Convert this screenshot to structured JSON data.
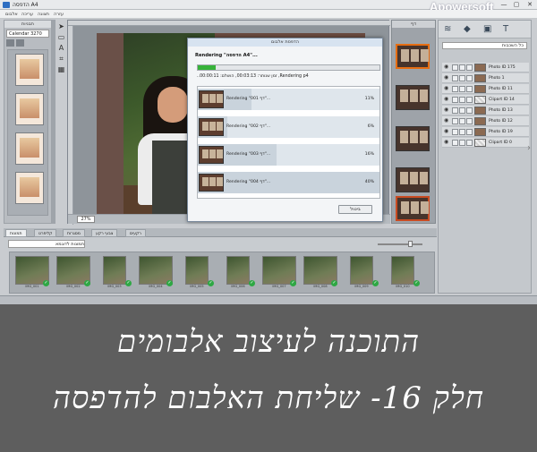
{
  "window": {
    "title": "הדפסה A4",
    "watermark": "Apowersoft",
    "controls": [
      "—",
      "▢",
      "✕"
    ]
  },
  "menu": {
    "items": [
      "אלבום",
      "עריכה",
      "תצוגה",
      "עזרה"
    ]
  },
  "left_panel": {
    "header": "תבניות",
    "dropdown": "Calendar 3270"
  },
  "canvas": {
    "zoom": "27%"
  },
  "render_dialog": {
    "title": "הדפסת אלבום",
    "heading": "Rendering \"הדפסה A4\"...",
    "progress_percent": 0.1,
    "status": "..זמן שנותר: 00:03:13, הושלם: 00:00:11 ,Rendering p4",
    "items": [
      {
        "label": "Rendering \"001 דף\"...",
        "percent": "11%",
        "progress": 0.11
      },
      {
        "label": "Rendering \"002 דף\"...",
        "percent": "6%",
        "progress": 0.06
      },
      {
        "label": "Rendering \"003 דף\"...",
        "percent": "16%",
        "progress": 0.16
      },
      {
        "label": "Rendering \"004 דף\"...",
        "percent": "40%",
        "progress": 0.4
      }
    ],
    "cancel_label": "ביטול"
  },
  "page_strip": {
    "header": "דף"
  },
  "layers": {
    "dropdown": "כל השכבות",
    "rows": [
      {
        "name": "Photo ID 175",
        "type": "photo"
      },
      {
        "name": "Photo 1",
        "type": "photo"
      },
      {
        "name": "Photo ID 11",
        "type": "photo"
      },
      {
        "name": "Clipart ID 14",
        "type": "clipart"
      },
      {
        "name": "Photo ID 13",
        "type": "photo"
      },
      {
        "name": "Photo ID 12",
        "type": "photo"
      },
      {
        "name": "Photo ID 19",
        "type": "photo"
      },
      {
        "name": "Clipart ID 0",
        "type": "clipart"
      }
    ]
  },
  "bottom": {
    "tabs": [
      "תמונות",
      "קליפרט",
      "מסגרות",
      "צבעי רקע",
      "רקעים"
    ],
    "dropdown": "תמונות לדוגמא",
    "photo_labels": [
      "IMG_001",
      "IMG_002",
      "IMG_003",
      "IMG_004",
      "IMG_005",
      "IMG_006",
      "IMG_007",
      "IMG_008",
      "IMG_009",
      "IMG_010"
    ],
    "check_mark": "✓"
  },
  "caption": {
    "line1": "התוכנה לעיצוב אלבומים",
    "line2": "חלק 16- שליחת האלבום להדפסה"
  }
}
